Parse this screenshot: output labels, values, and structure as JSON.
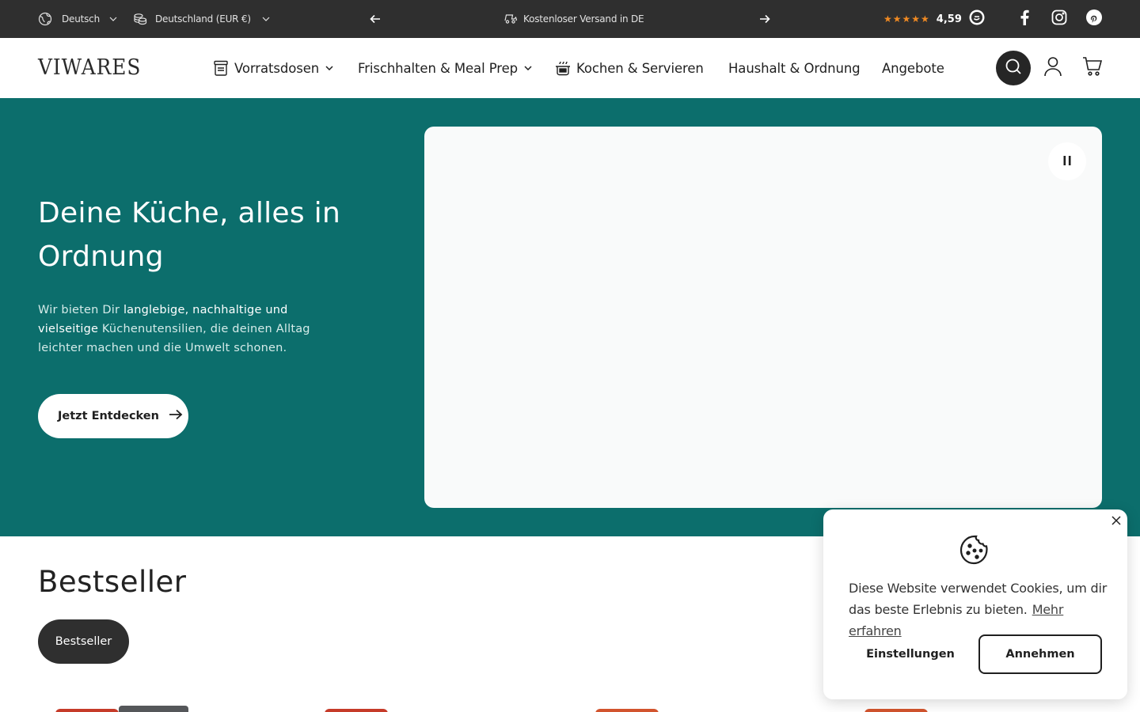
{
  "topbar": {
    "language": "Deutsch",
    "country": "Deutschland (EUR €)",
    "announcement": "Kostenloser Versand in DE",
    "rating_stars": "★★★★★",
    "rating_value": "4,59",
    "icons": [
      "globe-icon",
      "currency-icon",
      "chevron-down-icon",
      "arrow-left-icon",
      "truck-icon",
      "arrow-right-icon",
      "trusted-shops-icon",
      "facebook-icon",
      "instagram-icon",
      "pinterest-icon"
    ],
    "colors": {
      "background": "#2f2f2f",
      "stars": "#f08a23"
    }
  },
  "header": {
    "logo": "VIWARES",
    "nav": [
      {
        "label": "Vorratsdosen",
        "icon": "storage-jar-icon",
        "dropdown": true
      },
      {
        "label": "Frischhalten & Meal Prep",
        "dropdown": true
      },
      {
        "label": "Kochen & Servieren",
        "icon": "cooking-pot-icon",
        "dropdown": false
      },
      {
        "label": "Haushalt & Ordnung",
        "dropdown": false
      },
      {
        "label": "Angebote",
        "dropdown": false
      }
    ],
    "actions": [
      "search-icon",
      "account-icon",
      "cart-icon"
    ]
  },
  "hero": {
    "title": "Deine Küche, alles in Ordnung",
    "text_before": "Wir bieten Dir ",
    "text_strong": "langlebige, nachhaltige und vielseitige",
    "text_after": " Küchenutensilien, die deinen Alltag leichter machen und die Umwelt schonen.",
    "cta_label": "Jetzt Entdecken",
    "colors": {
      "background": "#0c6e6c"
    }
  },
  "bestseller": {
    "title": "Bestseller",
    "tab_label": "Bestseller"
  },
  "cookie": {
    "text": "Diese Website verwendet Cookies, um dir das beste Erlebnis zu bieten.",
    "link": "Mehr erfahren",
    "settings_label": "Einstellungen",
    "accept_label": "Annehmen"
  }
}
